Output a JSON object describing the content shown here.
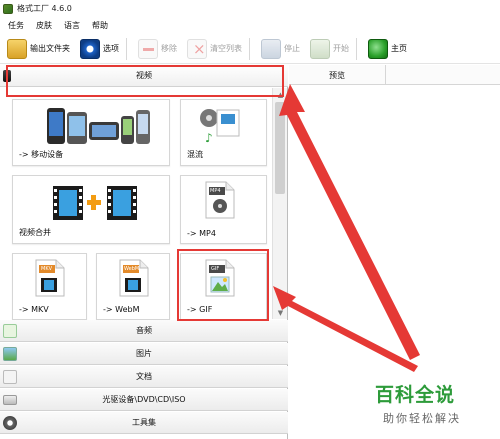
{
  "window": {
    "title": "格式工厂 4.6.0"
  },
  "menu": [
    "任务",
    "皮肤",
    "语言",
    "帮助"
  ],
  "toolbar": {
    "output_folder": "输出文件夹",
    "options": "选项",
    "remove": "移除",
    "clear_list": "清空列表",
    "stop": "停止",
    "start": "开始",
    "home": "主页"
  },
  "sections": {
    "video": "视频",
    "audio": "音频",
    "picture": "图片",
    "document": "文档",
    "optical": "光驱设备\\DVD\\CD\\ISO",
    "toolbox": "工具集"
  },
  "tiles": [
    {
      "label": "-> 移动设备",
      "icon": "mobile-devices-icon"
    },
    {
      "label": "混流",
      "icon": "mux-icon"
    },
    {
      "label": "视频合并",
      "icon": "video-join-icon"
    },
    {
      "label": "-> MP4",
      "icon": "mp4-file-icon"
    },
    {
      "label": "-> MKV",
      "icon": "mkv-file-icon"
    },
    {
      "label": "-> WebM",
      "icon": "webm-file-icon"
    },
    {
      "label": "-> GIF",
      "icon": "gif-file-icon"
    }
  ],
  "file_badges": {
    "mp4": "MP4",
    "mkv": "MKV",
    "webm": "WebM",
    "gif": "GIF"
  },
  "preview": {
    "header": "预览"
  },
  "watermark": {
    "title": "百科全说",
    "subtitle": "助你轻松解决"
  },
  "colors": {
    "annotation": "#e53935",
    "watermark_green": "#2d9b3a"
  }
}
